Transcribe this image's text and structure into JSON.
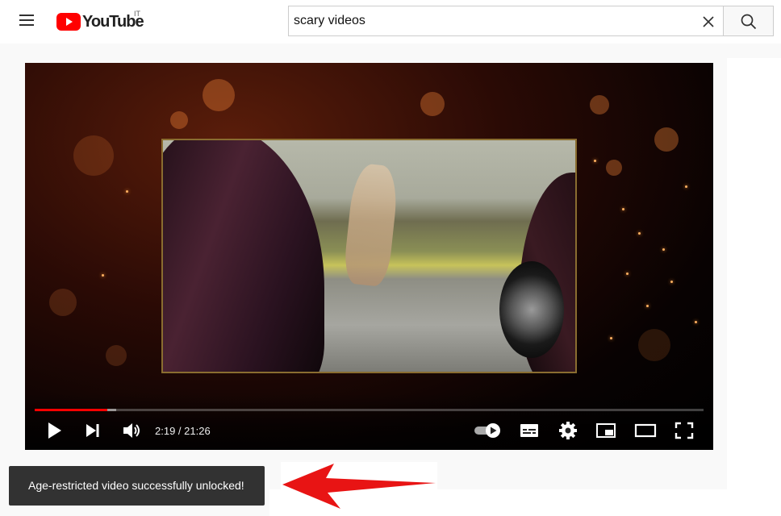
{
  "header": {
    "logo_text": "YouTube",
    "country_code": "IT",
    "search": {
      "value": "scary videos",
      "placeholder": "Search"
    }
  },
  "player": {
    "time_display": "2:19 / 21:26",
    "progress_played_fraction": 0.109,
    "progress_buffered_fraction": 0.122
  },
  "toast": {
    "message": "Age-restricted video successfully unlocked!"
  },
  "colors": {
    "brand_red": "#ff0000",
    "toast_bg": "#323232",
    "annotation_arrow": "#e81414"
  }
}
